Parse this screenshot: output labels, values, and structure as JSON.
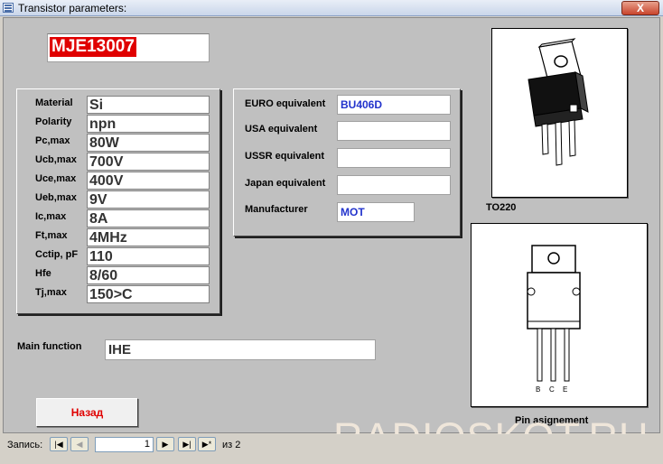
{
  "window": {
    "title": "Transistor parameters:",
    "close_label": "X"
  },
  "part_number": "MJE13007",
  "params": [
    {
      "label": "Material",
      "value": "Si"
    },
    {
      "label": "Polarity",
      "value": "npn"
    },
    {
      "label": "Pc,max",
      "value": "80W"
    },
    {
      "label": "Ucb,max",
      "value": "700V"
    },
    {
      "label": "Uce,max",
      "value": "400V"
    },
    {
      "label": "Ueb,max",
      "value": "9V"
    },
    {
      "label": "Ic,max",
      "value": "8A"
    },
    {
      "label": "Ft,max",
      "value": "4MHz"
    },
    {
      "label": "Cctip, pF",
      "value": "110"
    },
    {
      "label": "Hfe",
      "value": "8/60"
    },
    {
      "label": "Tj,max",
      "value": "150>C"
    }
  ],
  "equivalents": [
    {
      "label": "EURO equivalent",
      "value": "BU406D"
    },
    {
      "label": "USA equivalent",
      "value": ""
    },
    {
      "label": "USSR equivalent",
      "value": ""
    },
    {
      "label": "Japan equivalent",
      "value": ""
    },
    {
      "label": "Manufacturer",
      "value": "MOT"
    }
  ],
  "package": {
    "label": "TO220"
  },
  "pinout": {
    "label": "Pin asignement",
    "pins": [
      "B",
      "C",
      "E"
    ]
  },
  "main_function": {
    "label": "Main function",
    "value": "IHE"
  },
  "back_button": "Назад",
  "navigation": {
    "label": "Запись:",
    "current": "1",
    "of_label": "из",
    "total": "2"
  },
  "watermark": "RADIOSKOT.RU",
  "colors": {
    "part_bg": "#e00000",
    "equiv_text": "#2233cc",
    "button_text": "#e00000"
  }
}
